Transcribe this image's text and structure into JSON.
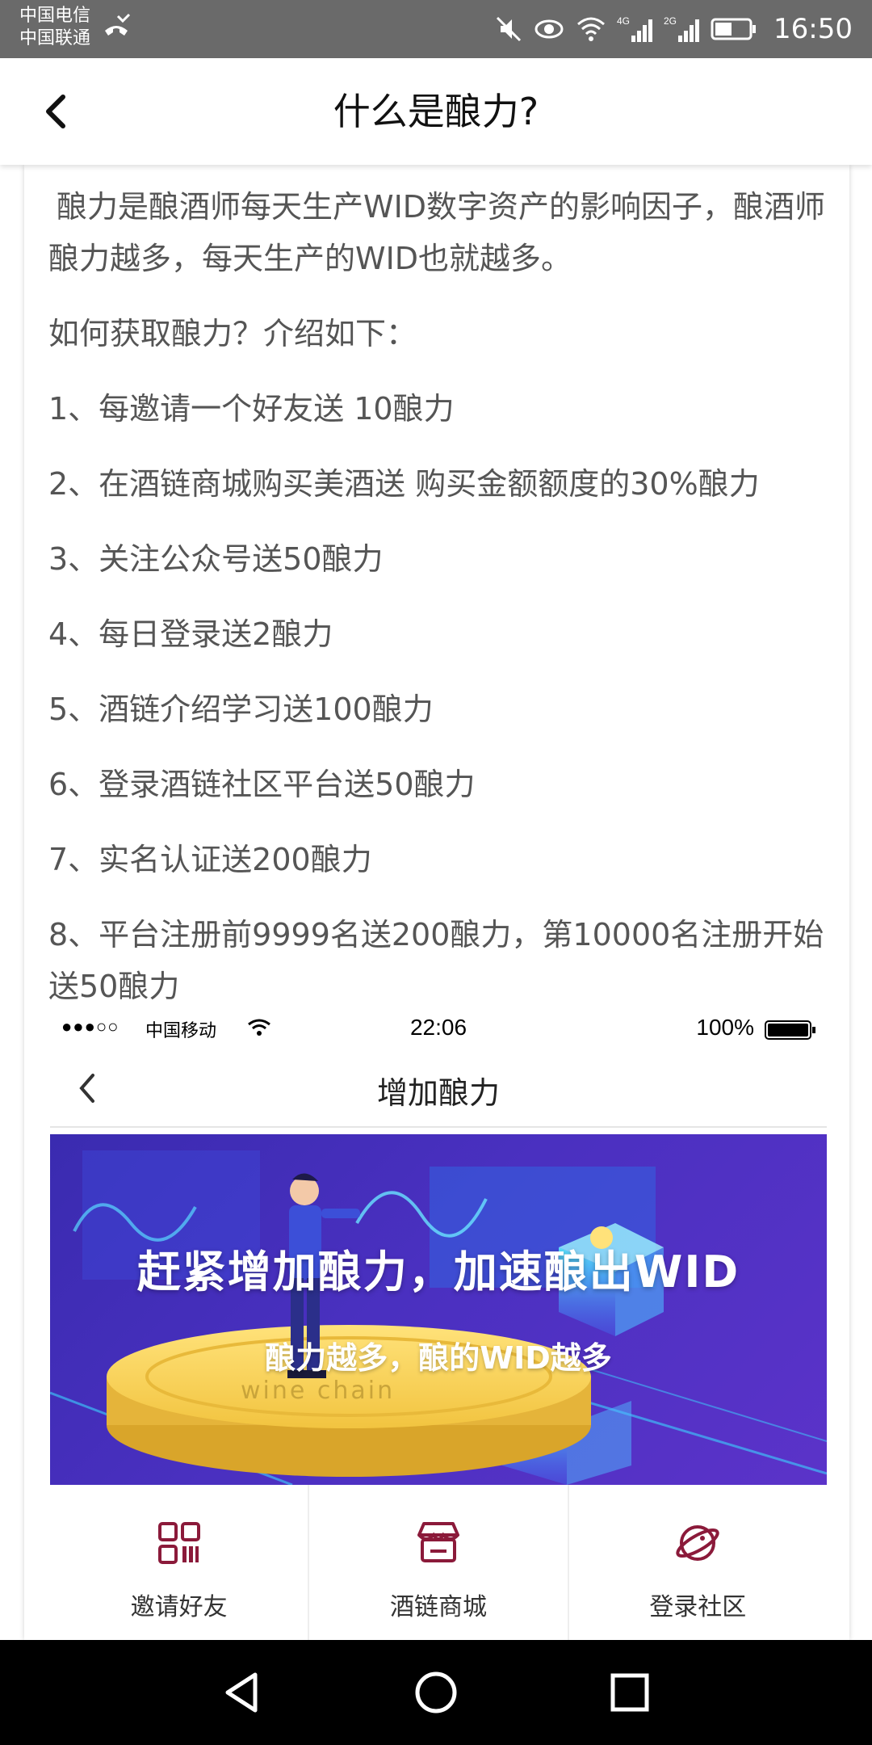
{
  "status_bar": {
    "carrier_1": "中国电信",
    "carrier_2": "中国联通",
    "network_1": "4G",
    "network_2": "2G",
    "time": "16:50",
    "icons": [
      "mute-icon",
      "eye-comfort-icon",
      "wifi-icon",
      "signal-icon",
      "battery-icon"
    ]
  },
  "header": {
    "title": "什么是酿力?"
  },
  "article": {
    "intro": "酿力是酿酒师每天生产WID数字资产的影响因子，酿酒师酿力越多，每天生产的WID也就越多。",
    "question": "如何获取酿力？介绍如下：",
    "items": [
      "1、每邀请一个好友送 10酿力",
      "2、在酒链商城购买美酒送 购买金额额度的30%酿力",
      "3、关注公众号送50酿力",
      "4、每日登录送2酿力",
      "5、酒链介绍学习送100酿力",
      "6、登录酒链社区平台送50酿力",
      "7、实名认证送200酿力",
      "8、平台注册前9999名送200酿力，第10000名注册开始送50酿力"
    ]
  },
  "embedded": {
    "ios_status": {
      "signal_dots": "●●●○○",
      "carrier": "中国移动",
      "time": "22:06",
      "battery": "100%"
    },
    "nav_title": "增加酿力",
    "banner": {
      "headline": "赶紧增加酿力，加速酿出WID",
      "subline": "酿力越多，酿的WID越多",
      "coin_text": "wine chain"
    },
    "actions": [
      {
        "label": "邀请好友",
        "icon": "qr-code-icon"
      },
      {
        "label": "酒链商城",
        "icon": "store-icon"
      },
      {
        "label": "登录社区",
        "icon": "planet-icon"
      }
    ],
    "accent_color": "#8b1a3a"
  },
  "nav_bar": {
    "buttons": [
      "back-triangle-icon",
      "home-circle-icon",
      "recents-square-icon"
    ]
  }
}
